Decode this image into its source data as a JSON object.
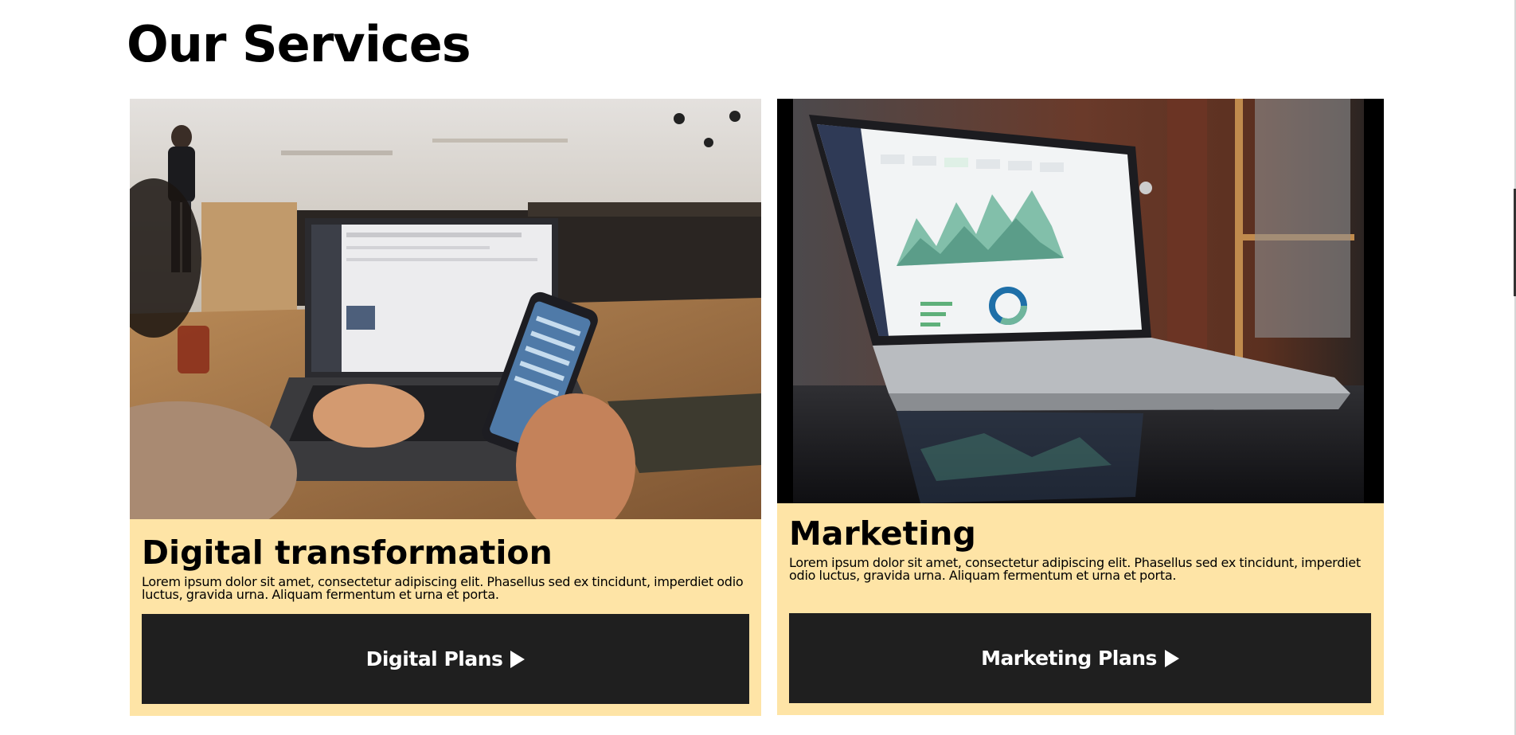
{
  "page": {
    "title": "Our Services"
  },
  "cards": [
    {
      "heading": "Digital transformation",
      "text": "Lorem ipsum dolor sit amet, consectetur adipiscing elit. Phasellus sed ex tincidunt, imperdiet odio luctus, gravida urna. Aliquam fermentum et urna et porta.",
      "button_label": "Digital Plans",
      "button_icon": "play-icon",
      "image": "photo-laptop-and-phone"
    },
    {
      "heading": "Marketing",
      "text": "Lorem ipsum dolor sit amet, consectetur adipiscing elit. Phasellus sed ex tincidunt, imperdiet odio luctus, gravida urna. Aliquam fermentum et urna et porta.",
      "button_label": "Marketing Plans",
      "button_icon": "play-icon",
      "image": "photo-laptop-analytics"
    }
  ],
  "colors": {
    "card_background": "#fee4a6",
    "button_background": "#1f1f1f",
    "button_text": "#ffffff"
  }
}
